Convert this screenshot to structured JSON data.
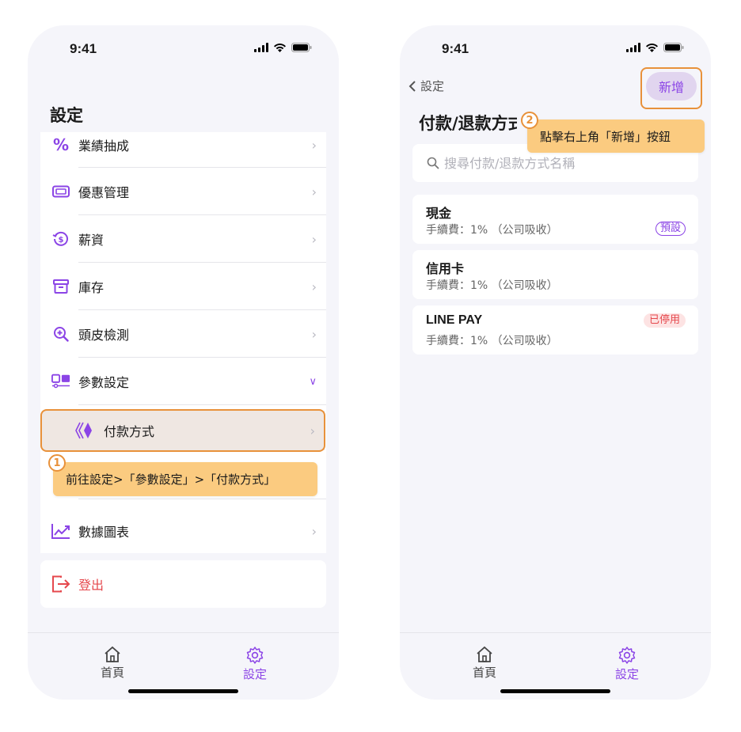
{
  "left_screen": {
    "status_time": "9:41",
    "page_title": "設定",
    "menu_items": [
      {
        "label": "業績抽成",
        "icon": "percent-icon"
      },
      {
        "label": "優惠管理",
        "icon": "ticket-icon"
      },
      {
        "label": "薪資",
        "icon": "salary-icon"
      },
      {
        "label": "庫存",
        "icon": "inventory-box-icon"
      },
      {
        "label": "頭皮檢測",
        "icon": "zoom-in-icon"
      },
      {
        "label": "參數設定",
        "icon": "parameters-icon"
      }
    ],
    "submenu_item": {
      "label": "付款方式",
      "icon": "payment-method-icon"
    },
    "chart_item": {
      "label": "數據圖表",
      "icon": "line-chart-icon"
    },
    "logout": {
      "label": "登出",
      "icon": "logout-icon"
    },
    "step_badge": "1",
    "tooltip": "前往設定>「參數設定」>「付款方式」",
    "tabs": [
      {
        "label": "首頁",
        "icon": "home-icon"
      },
      {
        "label": "設定",
        "icon": "gear-icon"
      }
    ],
    "accent_color": "#8b44e6",
    "highlight_color": "#e8913a",
    "logout_color": "#e5484d"
  },
  "right_screen": {
    "status_time": "9:41",
    "back_label": "設定",
    "add_button": "新增",
    "page_title": "付款/退款方式",
    "step_badge": "2",
    "tooltip": "點擊右上角「新增」按鈕",
    "search_placeholder": "搜尋付款/退款方式名稱",
    "methods": [
      {
        "name": "現金",
        "fee": "手續費：1% （公司吸收）",
        "badge": "預設"
      },
      {
        "name": "信用卡",
        "fee": "手續費：1% （公司吸收）",
        "badge": ""
      },
      {
        "name": "LINE PAY",
        "fee": "手續費：1% （公司吸收）",
        "badge": "已停用"
      }
    ],
    "tabs": [
      {
        "label": "首頁",
        "icon": "home-icon"
      },
      {
        "label": "設定",
        "icon": "gear-icon"
      }
    ]
  }
}
